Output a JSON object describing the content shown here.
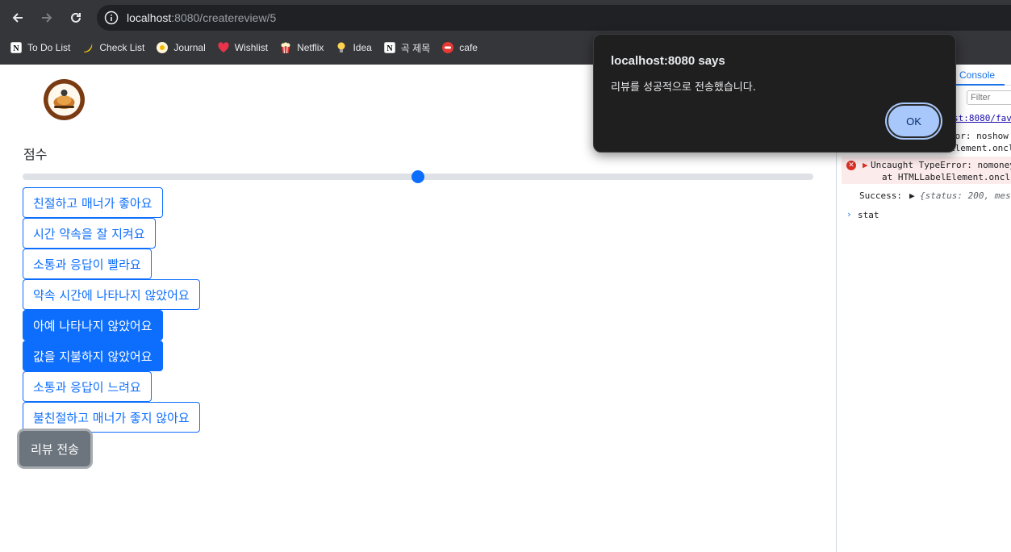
{
  "browser": {
    "url_host": "localhost",
    "url_rest": ":8080/createreview/5",
    "bookmarks": [
      {
        "label": "To Do List",
        "icon": "notion-icon"
      },
      {
        "label": "Check List",
        "icon": "banana-icon"
      },
      {
        "label": "Journal",
        "icon": "egg-icon"
      },
      {
        "label": "Wishlist",
        "icon": "heart-icon"
      },
      {
        "label": "Netflix",
        "icon": "popcorn-icon"
      },
      {
        "label": "Idea",
        "icon": "lightbulb-icon"
      },
      {
        "label": "곡 제목",
        "icon": "notion-icon"
      },
      {
        "label": "cafe",
        "icon": "cafe-icon"
      }
    ]
  },
  "page": {
    "score_label": "점수",
    "score_value": 0.5,
    "tags": [
      {
        "label": "친절하고 매너가 좋아요",
        "selected": false
      },
      {
        "label": "시간 약속을 잘 지켜요",
        "selected": false
      },
      {
        "label": "소통과 응답이 빨라요",
        "selected": false
      },
      {
        "label": "약속 시간에 나타나지 않았어요",
        "selected": false
      },
      {
        "label": "아예 나타나지 않았어요",
        "selected": true
      },
      {
        "label": "값을 지불하지 않았어요",
        "selected": true
      },
      {
        "label": "소통과 응답이 느려요",
        "selected": false
      },
      {
        "label": "불친절하고 매너가 좋지 않아요",
        "selected": false
      }
    ],
    "submit_label": "리뷰 전송"
  },
  "dialog": {
    "title": "localhost:8080 says",
    "message": "리뷰를 성공적으로 전송했습니다.",
    "ok_label": "OK"
  },
  "devtools": {
    "tab_console": "Console",
    "filter_placeholder": "Filter",
    "lines": {
      "l1": "st:8080/fav",
      "l2": "ror: noshow",
      "l3": "Element.oncli",
      "e1a": "Uncaught TypeError: nomoney",
      "e1b": "at HTMLLabelElement.oncli",
      "s1": "Success:",
      "s2": "{status: 200, mes",
      "prompt": "stat"
    }
  },
  "colors": {
    "primary": "#0d6efd",
    "secondary": "#6c757d",
    "dialog_bg": "#1f1f1f",
    "ok_button": "#a8c7fa"
  }
}
